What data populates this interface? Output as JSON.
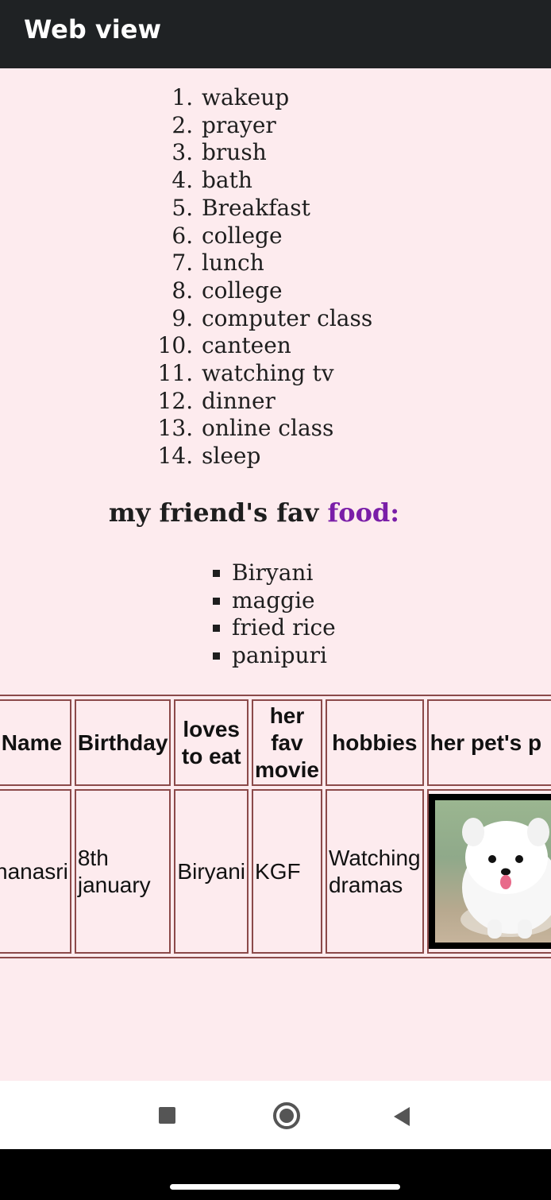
{
  "appbar": {
    "title": "Web view"
  },
  "routine": [
    "wakeup",
    "prayer",
    "brush",
    "bath",
    "Breakfast",
    "college",
    "lunch",
    "college",
    "computer class",
    "canteen",
    "watching tv",
    "dinner",
    "online class",
    "sleep"
  ],
  "fav_heading": {
    "part1": "my friend's fav ",
    "part2": "food:"
  },
  "foods": [
    "Biryani",
    "maggie",
    "fried rice",
    "panipuri"
  ],
  "table": {
    "headers": {
      "name": "Name",
      "birthday": "Birthday",
      "loves_to_eat": "loves to eat",
      "fav_movie": "her fav movie",
      "hobbies": "hobbies",
      "pet": "her pet's p"
    },
    "row": {
      "name": "hanasri",
      "birthday": "8th january",
      "loves_to_eat": "Biryani",
      "fav_movie": "KGF",
      "hobbies": "Watching dramas"
    }
  },
  "colors": {
    "accent_purple": "#7a1ea8",
    "page_bg": "#fdebee",
    "table_border": "#8b4a4a"
  },
  "icons": {
    "nav": [
      "recents-square-icon",
      "home-circle-icon",
      "back-triangle-icon"
    ]
  }
}
